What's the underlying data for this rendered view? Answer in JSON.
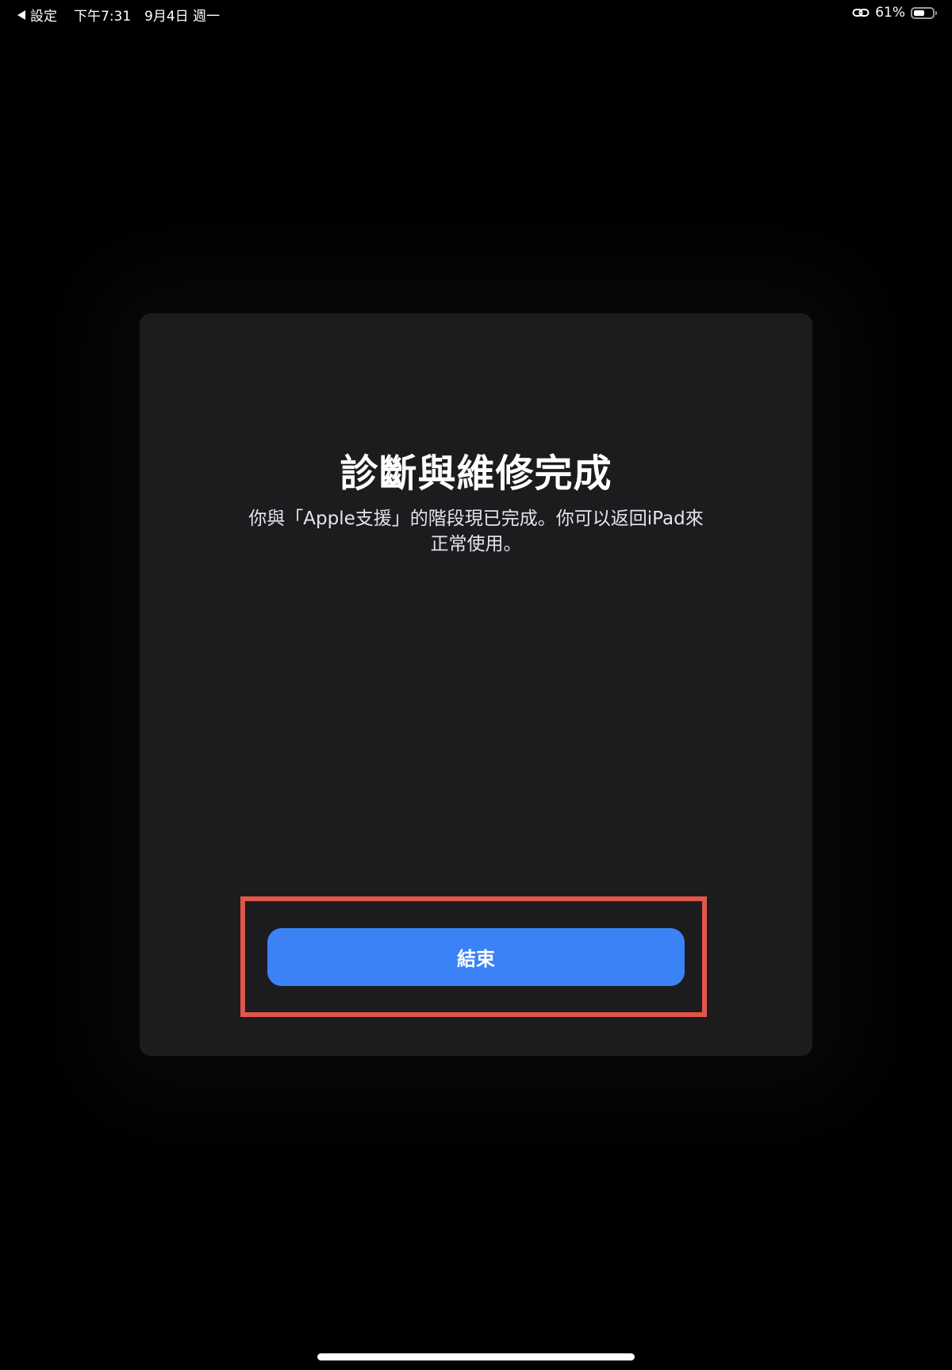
{
  "status_bar": {
    "back_label": "設定",
    "time": "下午7:31",
    "date": "9月4日 週一",
    "battery_percent_label": "61%",
    "battery_level": 0.61
  },
  "sheet": {
    "title": "診斷與維修完成",
    "description": "你與「Apple支援」的階段現已完成。你可以返回iPad來正常使用。",
    "finish_button_label": "結束"
  },
  "colors": {
    "background": "#000000",
    "card": "#1c1c1e",
    "button": "#3b82f6",
    "highlight": "#e2554b"
  },
  "icons": {
    "back": "back-triangle-icon",
    "link": "link-icon",
    "battery": "battery-icon"
  }
}
